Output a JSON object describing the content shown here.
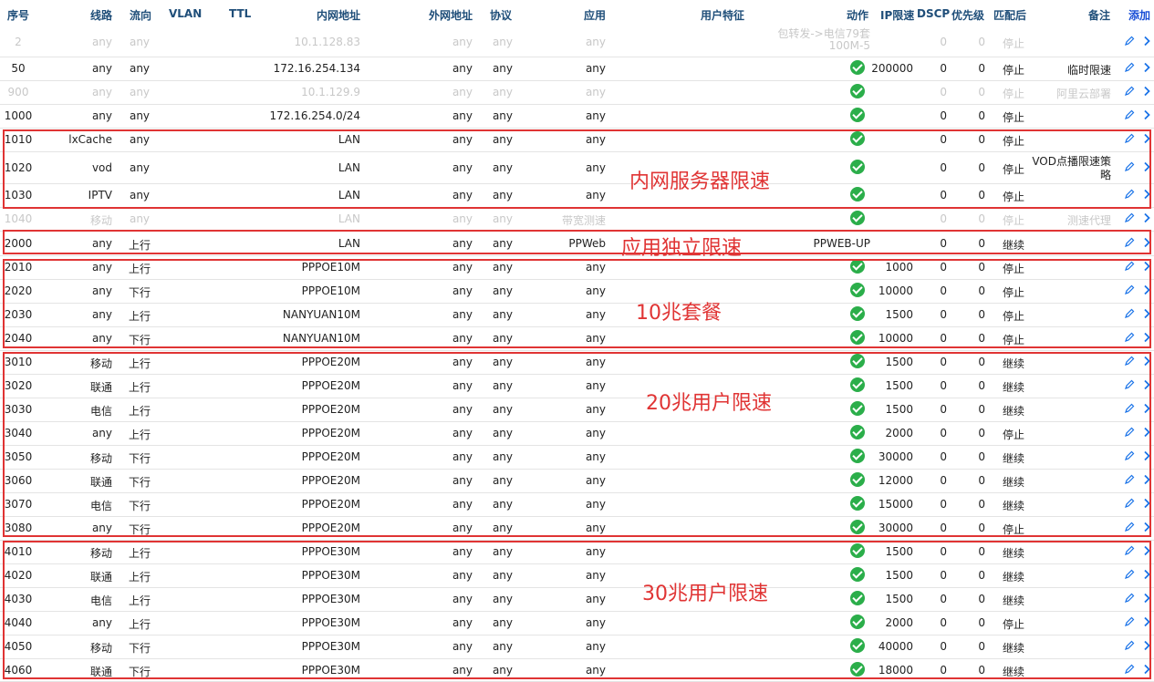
{
  "header": {
    "seq": "序号",
    "line": "线路",
    "dir": "流向",
    "vlan": "VLAN",
    "ttl": "TTL",
    "lan": "内网地址",
    "wan": "外网地址",
    "proto": "协议",
    "app": "应用",
    "userfeat": "用户特征",
    "action": "动作",
    "iplimit": "IP限速",
    "dscp": "DSCP",
    "prio": "优先级",
    "after": "匹配后",
    "note": "备注",
    "add": "添加"
  },
  "rows": [
    {
      "seq": "2",
      "line": "any",
      "dir": "any",
      "lan": "10.1.128.83",
      "wan": "any",
      "proto": "any",
      "app": "any",
      "action_text": "包转发->电信79套",
      "action_text2": "100M-5",
      "dscp": "0",
      "prio": "0",
      "after": "停止",
      "note": "",
      "disabled": true
    },
    {
      "seq": "50",
      "line": "any",
      "dir": "any",
      "lan": "172.16.254.134",
      "wan": "any",
      "proto": "any",
      "app": "any",
      "iplimit": "200000",
      "dscp": "0",
      "prio": "0",
      "after": "停止",
      "note": "临时限速"
    },
    {
      "seq": "900",
      "line": "any",
      "dir": "any",
      "lan": "10.1.129.9",
      "wan": "any",
      "proto": "any",
      "app": "any",
      "dscp": "0",
      "prio": "0",
      "after": "停止",
      "note": "阿里云部署",
      "disabled": true
    },
    {
      "seq": "1000",
      "line": "any",
      "dir": "any",
      "lan": "172.16.254.0/24",
      "wan": "any",
      "proto": "any",
      "app": "any",
      "dscp": "0",
      "prio": "0",
      "after": "停止",
      "note": ""
    },
    {
      "seq": "1010",
      "line": "lxCache",
      "dir": "any",
      "lan": "LAN",
      "wan": "any",
      "proto": "any",
      "app": "any",
      "dscp": "0",
      "prio": "0",
      "after": "停止",
      "note": ""
    },
    {
      "seq": "1020",
      "line": "vod",
      "dir": "any",
      "lan": "LAN",
      "wan": "any",
      "proto": "any",
      "app": "any",
      "dscp": "0",
      "prio": "0",
      "after": "停止",
      "note": "VOD点播限速策",
      "note2": "略"
    },
    {
      "seq": "1030",
      "line": "IPTV",
      "dir": "any",
      "lan": "LAN",
      "wan": "any",
      "proto": "any",
      "app": "any",
      "dscp": "0",
      "prio": "0",
      "after": "停止",
      "note": ""
    },
    {
      "seq": "1040",
      "line": "移动",
      "dir": "any",
      "lan": "LAN",
      "wan": "any",
      "proto": "any",
      "app": "带宽测速",
      "dscp": "0",
      "prio": "0",
      "after": "停止",
      "note": "测速代理",
      "disabled": true
    },
    {
      "seq": "2000",
      "line": "any",
      "dir": "上行",
      "lan": "LAN",
      "wan": "any",
      "proto": "any",
      "app": "PPWeb",
      "action_text": "PPWEB-UP",
      "dscp": "0",
      "prio": "0",
      "after": "继续",
      "note": ""
    },
    {
      "seq": "2010",
      "line": "any",
      "dir": "上行",
      "lan": "PPPOE10M",
      "wan": "any",
      "proto": "any",
      "app": "any",
      "iplimit": "1000",
      "dscp": "0",
      "prio": "0",
      "after": "停止",
      "note": ""
    },
    {
      "seq": "2020",
      "line": "any",
      "dir": "下行",
      "lan": "PPPOE10M",
      "wan": "any",
      "proto": "any",
      "app": "any",
      "iplimit": "10000",
      "dscp": "0",
      "prio": "0",
      "after": "停止",
      "note": ""
    },
    {
      "seq": "2030",
      "line": "any",
      "dir": "上行",
      "lan": "NANYUAN10M",
      "wan": "any",
      "proto": "any",
      "app": "any",
      "iplimit": "1500",
      "dscp": "0",
      "prio": "0",
      "after": "停止",
      "note": ""
    },
    {
      "seq": "2040",
      "line": "any",
      "dir": "下行",
      "lan": "NANYUAN10M",
      "wan": "any",
      "proto": "any",
      "app": "any",
      "iplimit": "10000",
      "dscp": "0",
      "prio": "0",
      "after": "停止",
      "note": ""
    },
    {
      "seq": "3010",
      "line": "移动",
      "dir": "上行",
      "lan": "PPPOE20M",
      "wan": "any",
      "proto": "any",
      "app": "any",
      "iplimit": "1500",
      "dscp": "0",
      "prio": "0",
      "after": "继续",
      "note": ""
    },
    {
      "seq": "3020",
      "line": "联通",
      "dir": "上行",
      "lan": "PPPOE20M",
      "wan": "any",
      "proto": "any",
      "app": "any",
      "iplimit": "1500",
      "dscp": "0",
      "prio": "0",
      "after": "继续",
      "note": ""
    },
    {
      "seq": "3030",
      "line": "电信",
      "dir": "上行",
      "lan": "PPPOE20M",
      "wan": "any",
      "proto": "any",
      "app": "any",
      "iplimit": "1500",
      "dscp": "0",
      "prio": "0",
      "after": "继续",
      "note": ""
    },
    {
      "seq": "3040",
      "line": "any",
      "dir": "上行",
      "lan": "PPPOE20M",
      "wan": "any",
      "proto": "any",
      "app": "any",
      "iplimit": "2000",
      "dscp": "0",
      "prio": "0",
      "after": "停止",
      "note": ""
    },
    {
      "seq": "3050",
      "line": "移动",
      "dir": "下行",
      "lan": "PPPOE20M",
      "wan": "any",
      "proto": "any",
      "app": "any",
      "iplimit": "30000",
      "dscp": "0",
      "prio": "0",
      "after": "继续",
      "note": ""
    },
    {
      "seq": "3060",
      "line": "联通",
      "dir": "下行",
      "lan": "PPPOE20M",
      "wan": "any",
      "proto": "any",
      "app": "any",
      "iplimit": "12000",
      "dscp": "0",
      "prio": "0",
      "after": "继续",
      "note": ""
    },
    {
      "seq": "3070",
      "line": "电信",
      "dir": "下行",
      "lan": "PPPOE20M",
      "wan": "any",
      "proto": "any",
      "app": "any",
      "iplimit": "15000",
      "dscp": "0",
      "prio": "0",
      "after": "继续",
      "note": ""
    },
    {
      "seq": "3080",
      "line": "any",
      "dir": "下行",
      "lan": "PPPOE20M",
      "wan": "any",
      "proto": "any",
      "app": "any",
      "iplimit": "30000",
      "dscp": "0",
      "prio": "0",
      "after": "停止",
      "note": ""
    },
    {
      "seq": "4010",
      "line": "移动",
      "dir": "上行",
      "lan": "PPPOE30M",
      "wan": "any",
      "proto": "any",
      "app": "any",
      "iplimit": "1500",
      "dscp": "0",
      "prio": "0",
      "after": "继续",
      "note": ""
    },
    {
      "seq": "4020",
      "line": "联通",
      "dir": "上行",
      "lan": "PPPOE30M",
      "wan": "any",
      "proto": "any",
      "app": "any",
      "iplimit": "1500",
      "dscp": "0",
      "prio": "0",
      "after": "继续",
      "note": ""
    },
    {
      "seq": "4030",
      "line": "电信",
      "dir": "上行",
      "lan": "PPPOE30M",
      "wan": "any",
      "proto": "any",
      "app": "any",
      "iplimit": "1500",
      "dscp": "0",
      "prio": "0",
      "after": "继续",
      "note": ""
    },
    {
      "seq": "4040",
      "line": "any",
      "dir": "上行",
      "lan": "PPPOE30M",
      "wan": "any",
      "proto": "any",
      "app": "any",
      "iplimit": "2000",
      "dscp": "0",
      "prio": "0",
      "after": "停止",
      "note": ""
    },
    {
      "seq": "4050",
      "line": "移动",
      "dir": "下行",
      "lan": "PPPOE30M",
      "wan": "any",
      "proto": "any",
      "app": "any",
      "iplimit": "40000",
      "dscp": "0",
      "prio": "0",
      "after": "继续",
      "note": ""
    },
    {
      "seq": "4060",
      "line": "联通",
      "dir": "下行",
      "lan": "PPPOE30M",
      "wan": "any",
      "proto": "any",
      "app": "any",
      "iplimit": "18000",
      "dscp": "0",
      "prio": "0",
      "after": "继续",
      "note": ""
    }
  ],
  "annotations": [
    "内网服务器限速",
    "应用独立限速",
    "10兆套餐",
    "20兆用户限速",
    "30兆用户限速"
  ],
  "colors": {
    "header_text": "#1f4e79",
    "check": "#2bae4a",
    "annotation": "#e03434",
    "add_link": "#1a4fd6",
    "disabled_text": "#c8c8c8"
  },
  "icons": {
    "action": "check-circle-icon",
    "edit": "pencil-icon",
    "detail": "chevron-right-icon"
  }
}
